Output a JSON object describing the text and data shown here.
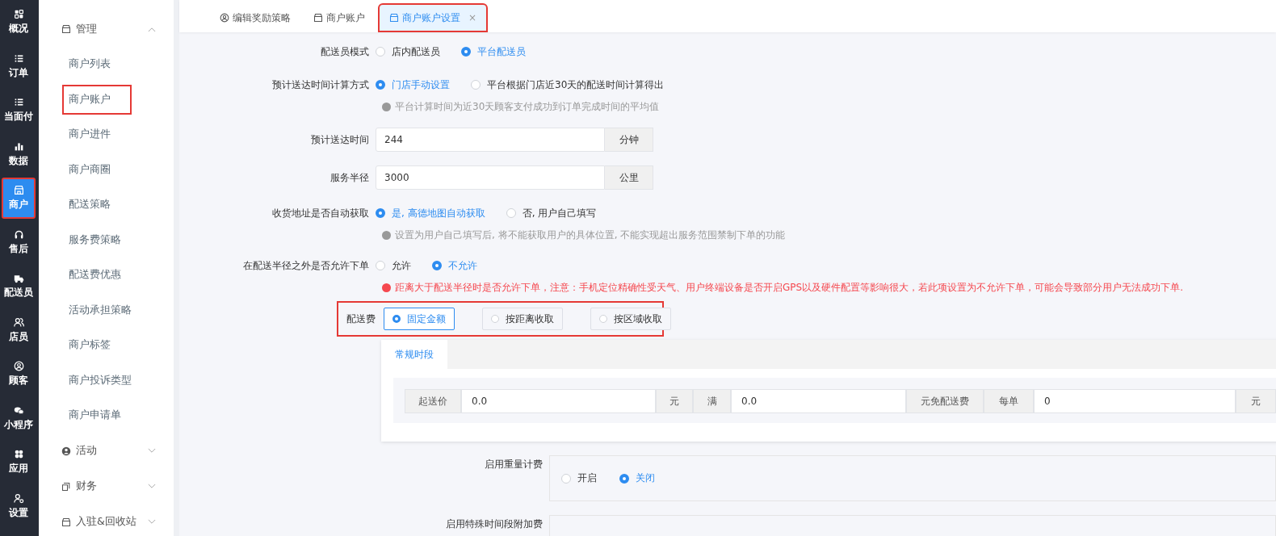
{
  "rail": [
    {
      "label": "概况",
      "selected": false,
      "highlighted": false
    },
    {
      "label": "订单",
      "selected": false,
      "highlighted": false
    },
    {
      "label": "当面付",
      "selected": false,
      "highlighted": false
    },
    {
      "label": "数据",
      "selected": false,
      "highlighted": false
    },
    {
      "label": "商户",
      "selected": true,
      "highlighted": true
    },
    {
      "label": "售后",
      "selected": false,
      "highlighted": false
    },
    {
      "label": "配送员",
      "selected": false,
      "highlighted": false
    },
    {
      "label": "店员",
      "selected": false,
      "highlighted": false
    },
    {
      "label": "顾客",
      "selected": false,
      "highlighted": false
    },
    {
      "label": "小程序",
      "selected": false,
      "highlighted": false
    },
    {
      "label": "应用",
      "selected": false,
      "highlighted": false
    },
    {
      "label": "设置",
      "selected": false,
      "highlighted": false
    }
  ],
  "sidebar": {
    "groups": [
      {
        "label": "管理",
        "expanded": true,
        "items": [
          {
            "label": "商户列表",
            "highlighted": false
          },
          {
            "label": "商户账户",
            "highlighted": true
          },
          {
            "label": "商户进件",
            "highlighted": false
          },
          {
            "label": "商户商圈",
            "highlighted": false
          },
          {
            "label": "配送策略",
            "highlighted": false
          },
          {
            "label": "服务费策略",
            "highlighted": false
          },
          {
            "label": "配送费优惠",
            "highlighted": false
          },
          {
            "label": "活动承担策略",
            "highlighted": false
          },
          {
            "label": "商户标签",
            "highlighted": false
          },
          {
            "label": "商户投诉类型",
            "highlighted": false
          },
          {
            "label": "商户申请单",
            "highlighted": false
          }
        ]
      },
      {
        "label": "活动",
        "expanded": false
      },
      {
        "label": "财务",
        "expanded": false
      },
      {
        "label": "入驻&回收站",
        "expanded": false
      }
    ]
  },
  "tabs": [
    {
      "label": "编辑奖励策略",
      "selected": false,
      "closable": false,
      "highlighted": false
    },
    {
      "label": "商户账户",
      "selected": false,
      "closable": false,
      "highlighted": false
    },
    {
      "label": "商户账户设置",
      "selected": true,
      "closable": true,
      "highlighted": true
    }
  ],
  "close_glyph": "×",
  "form": [
    {
      "kind": "radio",
      "label": "配送员模式",
      "options": [
        {
          "label": "店内配送员",
          "selected": false
        },
        {
          "label": "平台配送员",
          "selected": true
        }
      ]
    },
    {
      "kind": "radio",
      "label": "预计送达时间计算方式",
      "options": [
        {
          "label": "门店手动设置",
          "selected": true
        },
        {
          "label": "平台根据门店近30天的配送时间计算得出",
          "selected": false
        }
      ],
      "hint": {
        "kind": "info",
        "text": "平台计算时间为近30天顾客支付成功到订单完成时间的平均值"
      }
    },
    {
      "kind": "input",
      "label": "预计送达时间",
      "value": "244",
      "unit": "分钟"
    },
    {
      "kind": "input",
      "label": "服务半径",
      "value": "3000",
      "unit": "公里"
    },
    {
      "kind": "radio",
      "label": "收货地址是否自动获取",
      "options": [
        {
          "label": "是, 高德地图自动获取",
          "selected": true
        },
        {
          "label": "否, 用户自己填写",
          "selected": false
        }
      ],
      "hint": {
        "kind": "info",
        "text": "设置为用户自己填写后, 将不能获取用户的具体位置, 不能实现超出服务范围禁制下单的功能"
      }
    },
    {
      "kind": "radio",
      "label": "在配送半径之外是否允许下单",
      "options": [
        {
          "label": "允许",
          "selected": false
        },
        {
          "label": "不允许",
          "selected": true
        }
      ],
      "hint": {
        "kind": "warning",
        "text": "距离大于配送半径时是否允许下单，注意：手机定位精确性受天气、用户终端设备是否开启GPS以及硬件配置等影响很大，若此项设置为不允许下单，可能会导致部分用户无法成功下单."
      }
    }
  ],
  "fee": {
    "label": "配送费",
    "highlighted": true,
    "options": [
      {
        "label": "固定金额",
        "selected": true
      },
      {
        "label": "按距离收取",
        "selected": false
      },
      {
        "label": "按区域收取",
        "selected": false
      }
    ]
  },
  "fee_card": {
    "tabs": [
      {
        "label": "常规时段",
        "selected": true
      }
    ],
    "fields": [
      {
        "kind": "addon",
        "text": "起送价"
      },
      {
        "kind": "input",
        "value": "0.0"
      },
      {
        "kind": "addon",
        "text": "元"
      },
      {
        "kind": "addon",
        "text": "满"
      },
      {
        "kind": "input",
        "value": "0.0"
      },
      {
        "kind": "addon",
        "text": "元免配送费"
      },
      {
        "kind": "addon",
        "text": "每单"
      },
      {
        "kind": "input",
        "value": "0"
      },
      {
        "kind": "addon",
        "text": "元"
      }
    ]
  },
  "toggles": [
    {
      "label": "启用重量计费",
      "options": [
        {
          "label": "开启",
          "selected": false
        },
        {
          "label": "关闭",
          "selected": true
        }
      ]
    },
    {
      "label": "启用特殊时间段附加费"
    }
  ]
}
